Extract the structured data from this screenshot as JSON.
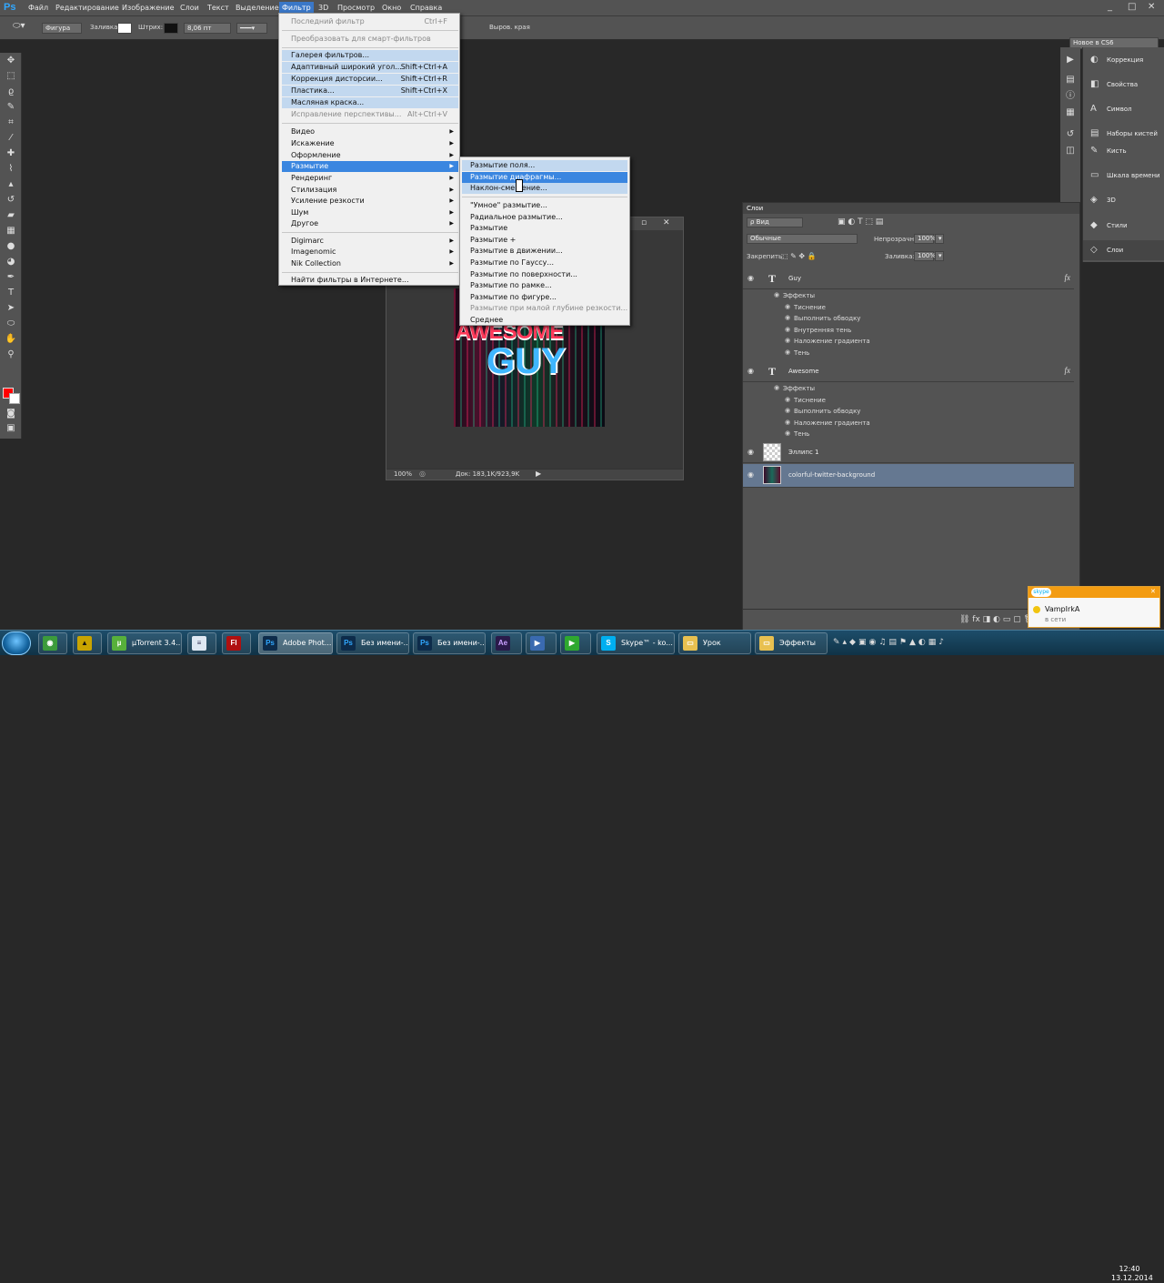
{
  "menubar": {
    "logo": "Ps",
    "items": [
      "Файл",
      "Редактирование",
      "Изображение",
      "Слои",
      "Текст",
      "Выделение",
      "Фильтр",
      "3D",
      "Просмотр",
      "Окно",
      "Справка"
    ],
    "selected_index": 6,
    "window_controls": {
      "minimize": "_",
      "maximize": "□",
      "close": "✕"
    }
  },
  "optbar": {
    "shape_mode": "Фигура",
    "fill_label": "Заливка:",
    "stroke_label": "Штрих:",
    "stroke_width": "8,06 пт",
    "align_edges": "Выров. края",
    "workspace": "Новое в CS6"
  },
  "filter_menu": {
    "last_filter": {
      "label": "Последний фильтр",
      "shortcut": "Ctrl+F"
    },
    "smart": "Преобразовать для смарт-фильтров",
    "group1": [
      {
        "label": "Галерея фильтров...",
        "shortcut": ""
      },
      {
        "label": "Адаптивный широкий угол...",
        "shortcut": "Shift+Ctrl+A"
      },
      {
        "label": "Коррекция дисторсии...",
        "shortcut": "Shift+Ctrl+R"
      },
      {
        "label": "Пластика...",
        "shortcut": "Shift+Ctrl+X"
      },
      {
        "label": "Масляная краска...",
        "shortcut": ""
      },
      {
        "label": "Исправление перспективы...",
        "shortcut": "Alt+Ctrl+V"
      }
    ],
    "group2": [
      "Видео",
      "Искажение",
      "Оформление",
      "Размытие",
      "Рендеринг",
      "Стилизация",
      "Усиление резкости",
      "Шум",
      "Другое"
    ],
    "group3": [
      "Digimarc",
      "Imagenomic",
      "Nik Collection"
    ],
    "online": "Найти фильтры в Интернете..."
  },
  "blur_menu": {
    "group1": [
      "Размытие поля...",
      "Размытие диафрагмы...",
      "Наклон-смещение..."
    ],
    "group2": [
      "\"Умное\" размытие...",
      "Радиальное размытие...",
      "Размытие",
      "Размытие +",
      "Размытие в движении...",
      "Размытие по Гауссу...",
      "Размытие по поверхности...",
      "Размытие по рамке...",
      "Размытие по фигуре...",
      "Размытие при малой глубине резкости...",
      "Среднее"
    ]
  },
  "document": {
    "zoom": "100%",
    "doc_size": "Док: 183,1K/923,9K",
    "art_line1": "AWESOME",
    "art_line2": "GUY"
  },
  "right_panels": {
    "items": [
      "Коррекция",
      "Свойства",
      "Символ",
      "Наборы кистей",
      "Кисть",
      "Шкала времени",
      "3D",
      "Стили",
      "Слои"
    ]
  },
  "layers": {
    "tab": "Слои",
    "filter_kind": "ρ Вид",
    "blend_mode": "Обычные",
    "opacity_label": "Непрозрачность:",
    "opacity": "100%",
    "lock_label": "Закрепить:",
    "fill_label": "Заливка:",
    "fill": "100%",
    "rows": [
      {
        "name": "Guy",
        "effects_label": "Эффекты",
        "effects": [
          "Тиснение",
          "Выполнить обводку",
          "Внутренняя тень",
          "Наложение градиента",
          "Тень"
        ]
      },
      {
        "name": "Awesome",
        "effects_label": "Эффекты",
        "effects": [
          "Тиснение",
          "Выполнить обводку",
          "Наложение градиента",
          "Тень"
        ]
      },
      {
        "name": "Эллипс 1"
      },
      {
        "name": "colorful-twitter-background"
      }
    ]
  },
  "taskbar": {
    "buttons": [
      "µTorrent 3.4...",
      "Adobe Phot...",
      "Без имени-...",
      "Без имени-...",
      "Skype™ - ko...",
      "Урок",
      "Эффекты"
    ],
    "time": "12:40",
    "date": "13.12.2014"
  },
  "skype_popup": {
    "logo": "skype",
    "name": "VampIrkA",
    "status": "в сети"
  },
  "colors": {
    "accent": "#3a86e0",
    "selected_layer": "#657891",
    "fg_color": "#ff0000",
    "bg_color": "#ffffff"
  }
}
